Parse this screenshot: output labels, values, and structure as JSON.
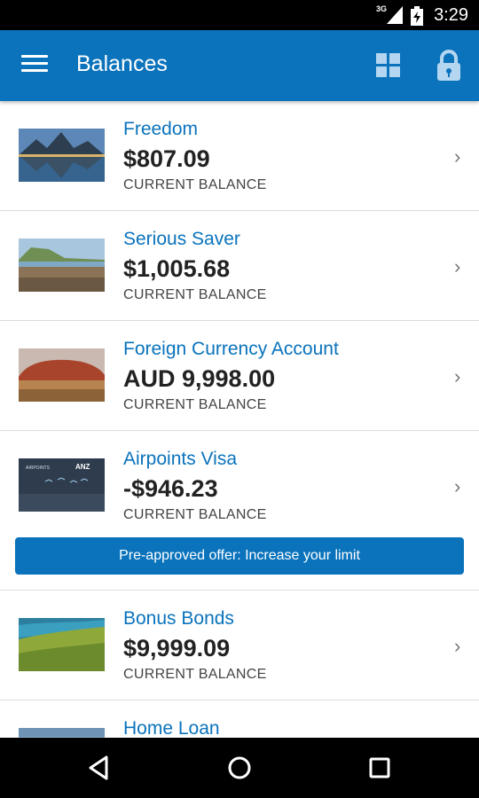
{
  "status_bar": {
    "time": "3:29",
    "network": "3G"
  },
  "app_bar": {
    "title": "Balances",
    "brand_color": "#0a73bc"
  },
  "accounts": [
    {
      "name": "Freedom",
      "amount": "$807.09",
      "label": "CURRENT BALANCE",
      "image": "mountain-lake"
    },
    {
      "name": "Serious Saver",
      "amount": "$1,005.68",
      "label": "CURRENT BALANCE",
      "image": "coastal-beach"
    },
    {
      "name": "Foreign Currency Account",
      "amount": "AUD 9,998.00",
      "label": "CURRENT BALANCE",
      "image": "uluru-rock"
    },
    {
      "name": "Airpoints Visa",
      "amount": "-$946.23",
      "label": "CURRENT BALANCE",
      "image": "airpoints-anz-card",
      "card_text": "AIRPOINTS",
      "card_brand": "ANZ"
    },
    {
      "name": "Bonus Bonds",
      "amount": "$9,999.09",
      "label": "CURRENT BALANCE",
      "image": "green-hills-coast"
    },
    {
      "name": "Home Loan",
      "image": "sky-horizon"
    }
  ],
  "offer": {
    "label": "Pre-approved offer: Increase your limit"
  },
  "chevron": "›",
  "nav_bar": {
    "icons": [
      "back-icon",
      "home-icon",
      "recents-icon"
    ]
  }
}
